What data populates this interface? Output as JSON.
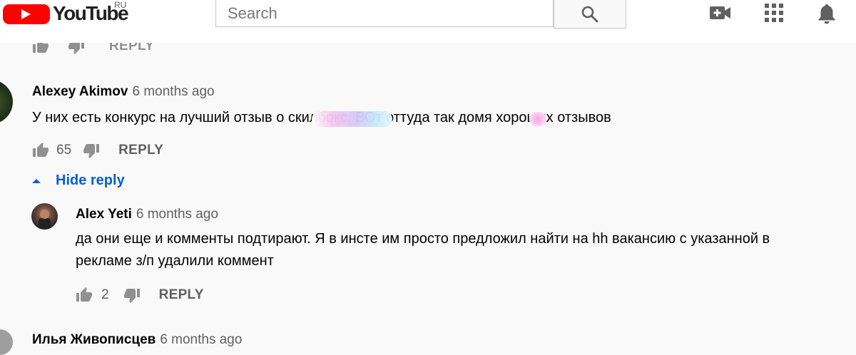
{
  "masthead": {
    "logo_text": "YouTube",
    "country_code": "RU",
    "search_placeholder": "Search",
    "icons": [
      "search-icon",
      "create-video-icon",
      "apps-grid-icon",
      "notifications-bell-icon"
    ]
  },
  "top_partial_row": {
    "reply_label": "REPLY"
  },
  "comments": [
    {
      "author": "Alexey Akimov",
      "time": "6 months ago",
      "text": "У них есть конкурс на лучший отзыв о скилбокс. ВОт оттуда так домя хороших отзывов",
      "likes": "65",
      "reply_label": "REPLY"
    }
  ],
  "hide_reply_label": "Hide reply",
  "reply": {
    "author": "Alex Yeti",
    "time": "6 months ago",
    "text_line1": "да они еще и комменты подтирают. Я в инсте им просто предложил найти на hh вакансию с указанной в",
    "text_line2": "рекламе з/п удалили коммент",
    "likes": "2",
    "reply_label": "REPLY"
  },
  "next_comment": {
    "author": "Илья Живописцев",
    "time": "6 months ago"
  }
}
